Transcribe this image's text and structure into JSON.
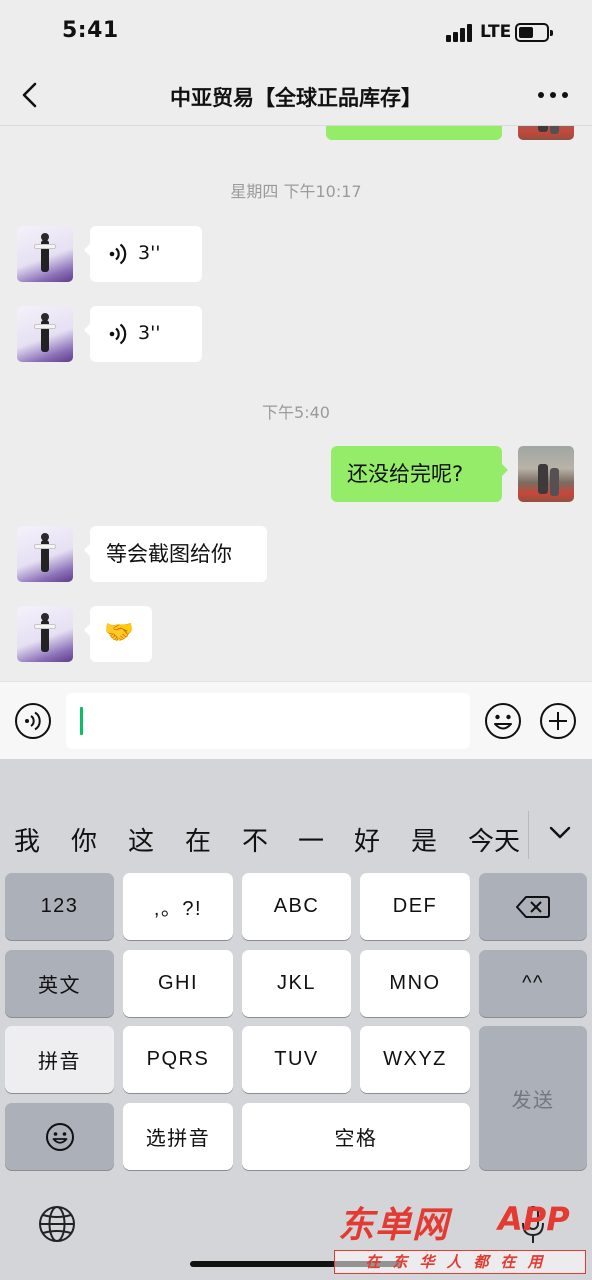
{
  "status_bar": {
    "time": "5:41",
    "network": "LTE"
  },
  "header": {
    "title": "中亚贸易【全球正品库存】",
    "back_icon": "chevron-left-icon",
    "more_icon": "more-dots-icon"
  },
  "chat": {
    "messages": [
      {
        "type": "timestamp",
        "text": "星期四 下午10:17"
      },
      {
        "type": "voice",
        "side": "left",
        "duration": "3''"
      },
      {
        "type": "voice",
        "side": "left",
        "duration": "3''"
      },
      {
        "type": "timestamp",
        "text": "下午5:40"
      },
      {
        "type": "text",
        "side": "right",
        "text": "还没给完呢?"
      },
      {
        "type": "text",
        "side": "left",
        "text": "等会截图给你"
      },
      {
        "type": "emoji",
        "side": "left",
        "text": "🤝"
      }
    ]
  },
  "input_bar": {
    "voice_icon": "voice-toggle-icon",
    "emoji_icon": "emoji-icon",
    "plus_icon": "plus-icon",
    "value": ""
  },
  "keyboard": {
    "candidates": [
      "我",
      "你",
      "这",
      "在",
      "不",
      "一",
      "好",
      "是",
      "今天"
    ],
    "keys": {
      "numbers": "123",
      "punct": ",。?!",
      "abc": "ABC",
      "def": "DEF",
      "english": "英文",
      "ghi": "GHI",
      "jkl": "JKL",
      "mno": "MNO",
      "face": "^^",
      "pinyin": "拼音",
      "pqrs": "PQRS",
      "tuv": "TUV",
      "wxyz": "WXYZ",
      "send": "发送",
      "select_pinyin": "选拼音",
      "space": "空格"
    }
  },
  "watermark": {
    "main": "东单网",
    "app": "APP",
    "slogan": "在东华人都在用"
  },
  "colors": {
    "sent_bubble": "#95ec69",
    "cursor": "#07c160",
    "watermark": "#e33b31"
  }
}
